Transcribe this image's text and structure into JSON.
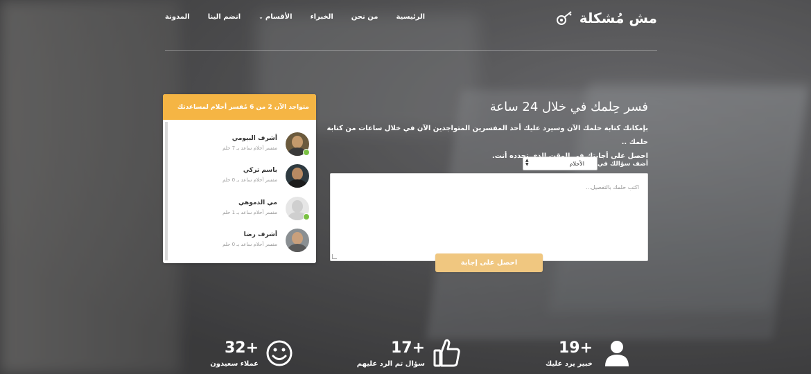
{
  "header": {
    "logo_text": "مش مُشكلة",
    "nav": [
      {
        "label": "الرئيسية"
      },
      {
        "label": "من نحن"
      },
      {
        "label": "الخبراء"
      },
      {
        "label": "الأقسام"
      },
      {
        "label": "انضم الينا"
      },
      {
        "label": "المدونة"
      }
    ]
  },
  "experts_panel": {
    "title": "متواجد الآن 2 من 6 مُفسر أحلام لمساعدتك",
    "experts": [
      {
        "name": "أشرف البيومي",
        "info": "مفسر أحلام ساعد بـ 7 حلم",
        "online": true
      },
      {
        "name": "باسم تركي",
        "info": "مفسر أحلام ساعد بـ 0 حلم",
        "online": false
      },
      {
        "name": "مي الدموهي",
        "info": "مفسر أحلام ساعد بـ 1 حلم",
        "online": true
      },
      {
        "name": "أشرف رضا",
        "info": "مفسر أحلام ساعد بـ 0 حلم",
        "online": false
      }
    ]
  },
  "question": {
    "title": "فسر حِلمك في خلال 24 ساعة",
    "desc_line1": "بإمكانك كتابة حلمك الآن وسيرد عليك أحد المفسرين المتواجدين الآن في خلال ساعات من كتابة حلمك ..",
    "desc_line2": "احصل على أجابتك في الوقت الذي تحدده أنت.",
    "select_label": "أضف سؤالك في :",
    "select_value": "الأحلام",
    "textarea_placeholder": "اكتب حلمك بالتفصيل...",
    "submit_label": "احصل على إجابة"
  },
  "stats": [
    {
      "number": "+19",
      "label": "خبير يرد عليك",
      "icon": "user-icon"
    },
    {
      "number": "+17",
      "label": "سؤال تم الرد عليهم",
      "icon": "thumbs-up-icon"
    },
    {
      "number": "+32",
      "label": "عملاء سعيدون",
      "icon": "smiley-icon"
    }
  ],
  "colors": {
    "accent": "#f5b544",
    "button": "#f0c780",
    "online": "#7ac143"
  }
}
